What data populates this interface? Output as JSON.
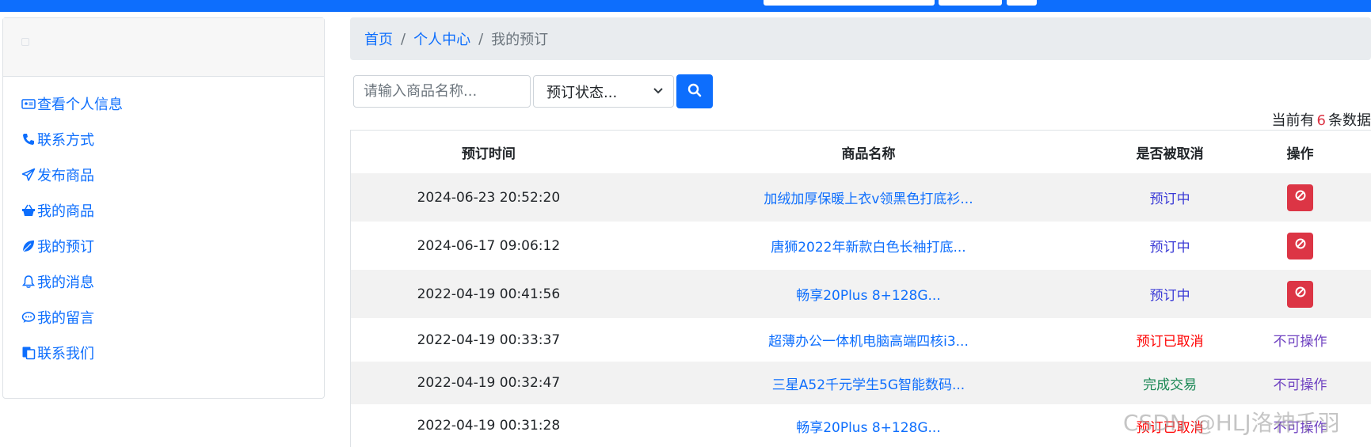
{
  "breadcrumb": {
    "home": "首页",
    "personal_center": "个人中心",
    "current": "我的预订",
    "separator": "/"
  },
  "sidebar": {
    "items": [
      {
        "label": "查看个人信息",
        "icon": "id-card-icon"
      },
      {
        "label": "联系方式",
        "icon": "phone-icon"
      },
      {
        "label": "发布商品",
        "icon": "send-icon"
      },
      {
        "label": "我的商品",
        "icon": "basket-icon"
      },
      {
        "label": "我的预订",
        "icon": "leaf-icon"
      },
      {
        "label": "我的消息",
        "icon": "bell-icon"
      },
      {
        "label": "我的留言",
        "icon": "chat-icon"
      },
      {
        "label": "联系我们",
        "icon": "contact-icon"
      }
    ]
  },
  "filters": {
    "search_placeholder": "请输入商品名称...",
    "status_placeholder": "预订状态..."
  },
  "summary": {
    "prefix": "当前有",
    "count": "6",
    "suffix": "条数据"
  },
  "table": {
    "headers": [
      "预订时间",
      "商品名称",
      "是否被取消",
      "操作"
    ],
    "rows": [
      {
        "time": "2024-06-23 20:52:20",
        "name": "加绒加厚保暖上衣v领黑色打底衫...",
        "status": "预订中",
        "status_type": "pending",
        "action": "cancel-icon"
      },
      {
        "time": "2024-06-17 09:06:12",
        "name": "唐狮2022年新款白色长袖打底...",
        "status": "预订中",
        "status_type": "pending",
        "action": "cancel-icon"
      },
      {
        "time": "2022-04-19 00:41:56",
        "name": "畅享20Plus 8+128G...",
        "status": "预订中",
        "status_type": "pending",
        "action": "cancel-icon"
      },
      {
        "time": "2022-04-19 00:33:37",
        "name": "超薄办公一体机电脑高端四核i3...",
        "status": "预订已取消",
        "status_type": "cancelled",
        "action": "不可操作"
      },
      {
        "time": "2022-04-19 00:32:47",
        "name": "三星A52千元学生5G智能数码...",
        "status": "完成交易",
        "status_type": "done",
        "action": "不可操作"
      },
      {
        "time": "2022-04-19 00:31:28",
        "name": "畅享20Plus 8+128G...",
        "status": "预订已取消",
        "status_type": "cancelled",
        "action": "不可操作"
      }
    ]
  },
  "watermark": "CSDN @HLJ洛神千羽",
  "colors": {
    "primary": "#0d6efd",
    "danger": "#dc3545",
    "pending": "#3b3bd6",
    "cancelled": "#ff0000",
    "done": "#198754",
    "not_operable": "#6f42c1"
  }
}
